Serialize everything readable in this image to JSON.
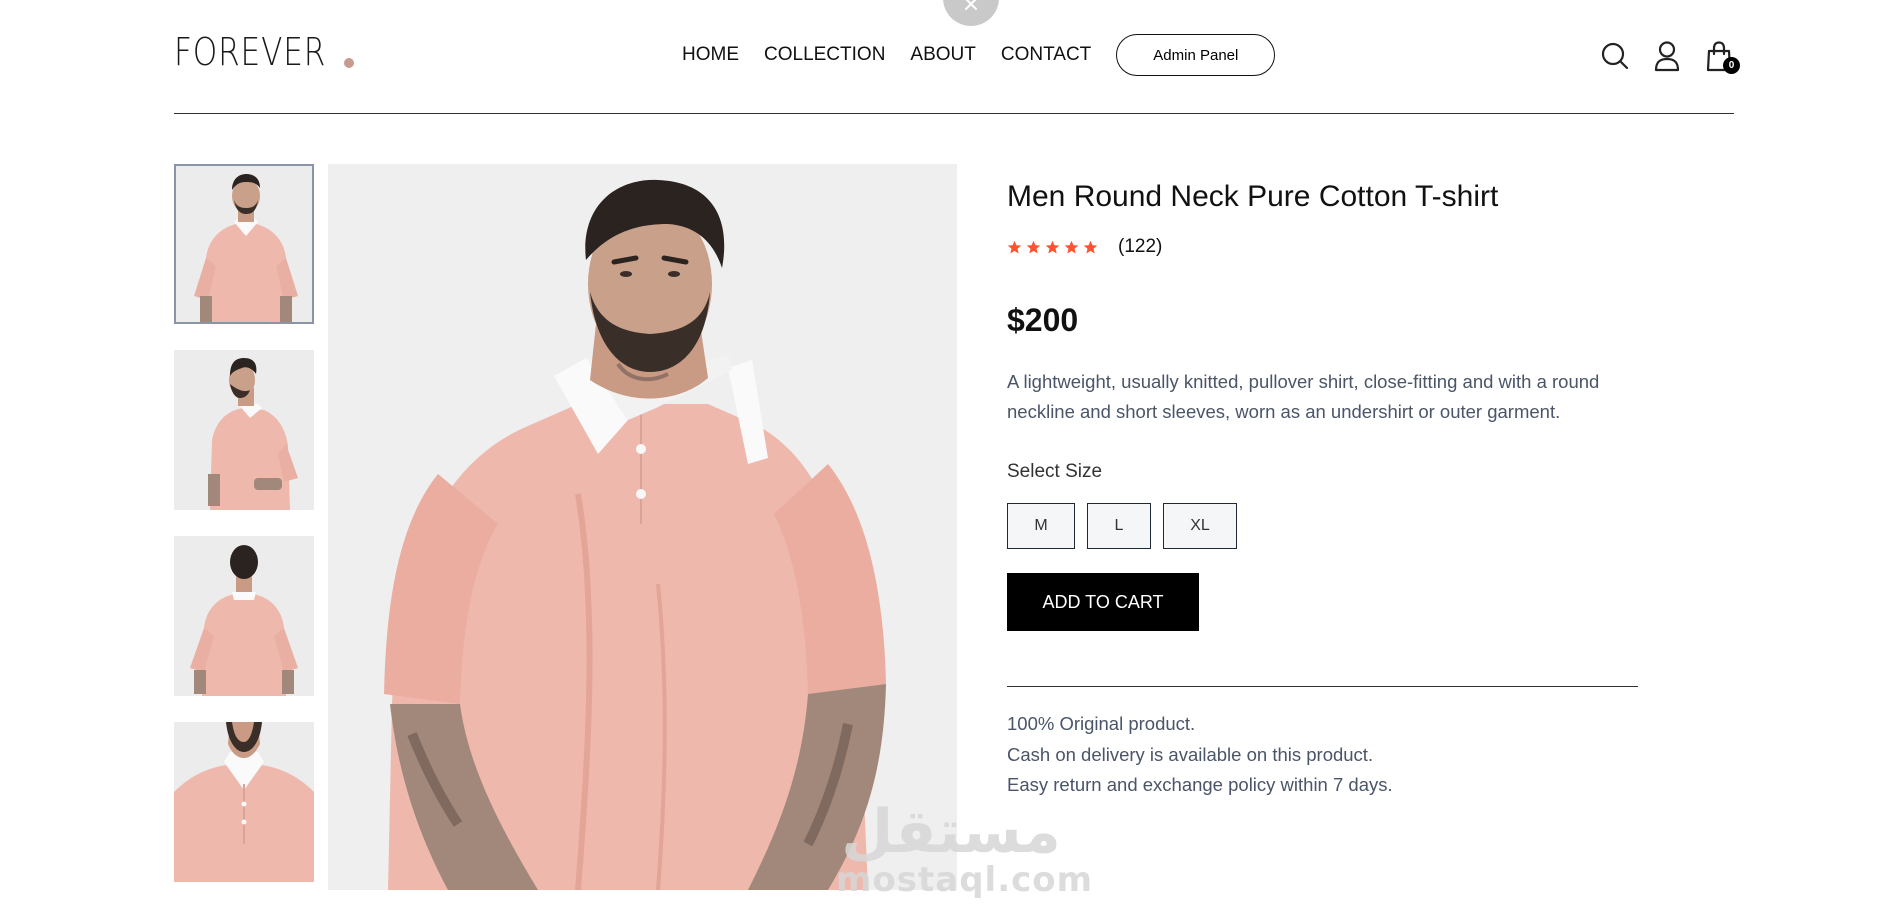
{
  "header": {
    "logo_text": "FOREVER",
    "nav": [
      "HOME",
      "COLLECTION",
      "ABOUT",
      "CONTACT"
    ],
    "admin_button": "Admin Panel",
    "cart_count": "0"
  },
  "gallery": {
    "thumbnails": [
      "front-view",
      "side-view",
      "back-view",
      "collar-closeup"
    ],
    "active_index": 0
  },
  "product": {
    "name": "Men Round Neck Pure Cotton T-shirt",
    "rating": 5,
    "review_count": "(122)",
    "price": "$200",
    "description": "A lightweight, usually knitted, pullover shirt, close-fitting and with a round neckline and short sleeves, worn as an undershirt or outer garment.",
    "size_label": "Select Size",
    "sizes": [
      "M",
      "L",
      "XL"
    ],
    "add_to_cart": "ADD TO CART",
    "policies": [
      "100% Original product.",
      "Cash on delivery is available on this product.",
      "Easy return and exchange policy within 7 days."
    ]
  },
  "watermark": {
    "arabic": "مستقل",
    "latin": "mostaql.com"
  },
  "colors": {
    "accent_star": "#ff532e",
    "shirt_pink": "#efb8ad",
    "logo_dot": "#c99a8f"
  }
}
